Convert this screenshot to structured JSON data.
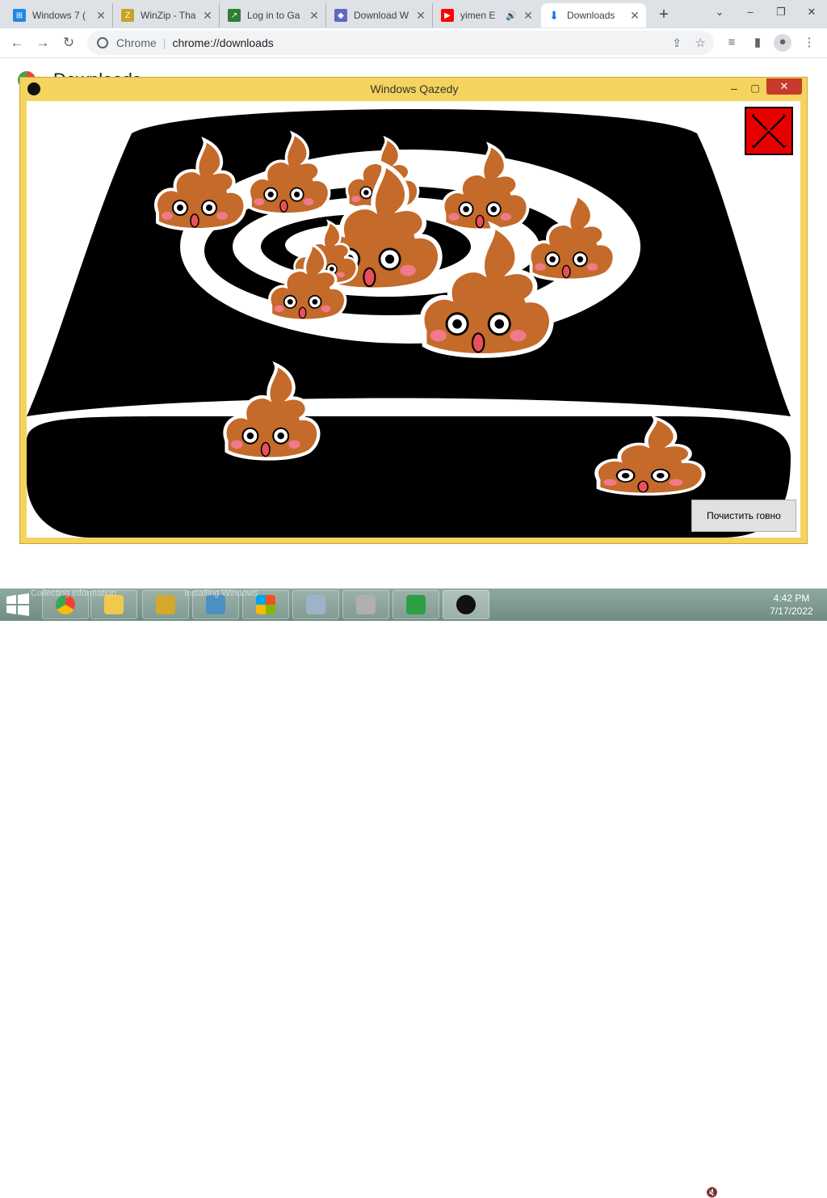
{
  "browser": {
    "tabs": [
      {
        "title": "Windows 7 (",
        "icon": "windows-flag-icon",
        "color": "#1e88e5"
      },
      {
        "title": "WinZip - Tha",
        "icon": "winzip-icon",
        "color": "#c9a227"
      },
      {
        "title": "Log in to Ga",
        "icon": "game-icon",
        "color": "#2e7d32"
      },
      {
        "title": "Download W",
        "icon": "shield-icon",
        "color": "#5c6bc0"
      },
      {
        "title": "yimen E",
        "icon": "youtube-icon",
        "color": "#ff0000"
      },
      {
        "title": "Downloads",
        "icon": "download-icon",
        "color": "#1a73e8"
      }
    ],
    "new_tab": "+",
    "omnibox_site": "Chrome",
    "omnibox_url": "chrome://downloads",
    "page_title": "Downloads"
  },
  "dialog": {
    "title": "Windows Qazedy",
    "min": "–",
    "max": "▢",
    "close": "✕",
    "clean_button": "Почистить говно"
  },
  "taskbar": {
    "ghost_left": "Collecting information",
    "ghost_mid": "Installing Windows",
    "time": "4:42 PM",
    "date": "7/17/2022"
  }
}
